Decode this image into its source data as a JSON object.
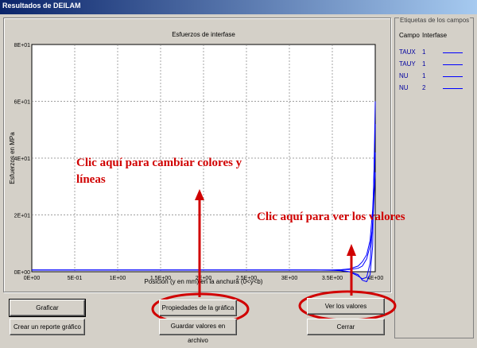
{
  "window": {
    "title": "Resultados de DEILAM"
  },
  "legend": {
    "group_title": "Etiquetas de los campos",
    "col_campo": "Campo",
    "col_interfase": "Interfase",
    "rows": [
      {
        "campo": "TAUX",
        "interfase": "1"
      },
      {
        "campo": "TAUY",
        "interfase": "1"
      },
      {
        "campo": "NU",
        "interfase": "1"
      },
      {
        "campo": "NU",
        "interfase": "2"
      }
    ]
  },
  "chart_data": {
    "type": "line",
    "title": "Esfuerzos de interfase",
    "xlabel": "Posición (y en mm) en la anchura (0<y<b)",
    "ylabel": "Esfuerzos en MPa",
    "xlim": [
      0,
      4
    ],
    "ylim": [
      0,
      8
    ],
    "x_ticks": [
      "0E+00",
      "5E-01",
      "1E+00",
      "1.5E+00",
      "2E+00",
      "2.5E+00",
      "3E+00",
      "3.5E+00",
      "4E+00"
    ],
    "x_tick_values": [
      0,
      0.5,
      1,
      1.5,
      2,
      2.5,
      3,
      3.5,
      4
    ],
    "y_ticks": [
      "0E+00",
      "2E+01",
      "4E+01",
      "6E+01",
      "8E+01"
    ],
    "y_tick_values": [
      0,
      2,
      4,
      6,
      8
    ],
    "grid": true,
    "color": "#0000ff",
    "series": [
      {
        "x": [
          0,
          0.5,
          1,
          1.5,
          2,
          2.5,
          3,
          3.3,
          3.5,
          3.6,
          3.7,
          3.8,
          3.85,
          3.9,
          3.94,
          3.97,
          4.0
        ],
        "y": [
          0.06,
          0.06,
          0.06,
          0.06,
          0.06,
          0.06,
          0.06,
          0.06,
          0.06,
          0.07,
          0.08,
          0.12,
          0.2,
          0.45,
          0.9,
          1.6,
          3.5
        ]
      },
      {
        "x": [
          0,
          0.5,
          1,
          1.5,
          2,
          2.5,
          3,
          3.3,
          3.5,
          3.6,
          3.7,
          3.8,
          3.85,
          3.9,
          3.94,
          3.97,
          4.0
        ],
        "y": [
          0.06,
          0.06,
          0.06,
          0.06,
          0.06,
          0.06,
          0.06,
          0.06,
          0.05,
          0.04,
          0.0,
          -0.15,
          -0.25,
          -0.2,
          0.3,
          1.8,
          5.2
        ]
      },
      {
        "x": [
          0,
          0.5,
          1,
          1.5,
          2,
          2.5,
          3,
          3.3,
          3.5,
          3.6,
          3.7,
          3.8,
          3.85,
          3.9,
          3.94,
          3.97,
          4.0
        ],
        "y": [
          0.06,
          0.06,
          0.06,
          0.06,
          0.06,
          0.06,
          0.06,
          0.06,
          0.06,
          0.07,
          0.1,
          0.2,
          0.35,
          0.6,
          1.1,
          2.2,
          4.2
        ]
      },
      {
        "x": [
          0,
          0.5,
          1,
          1.5,
          2,
          2.5,
          3,
          3.3,
          3.5,
          3.6,
          3.7,
          3.8,
          3.85,
          3.9,
          3.94,
          3.97,
          4.0
        ],
        "y": [
          0.06,
          0.06,
          0.06,
          0.06,
          0.06,
          0.06,
          0.06,
          0.06,
          0.06,
          0.05,
          0.0,
          -0.1,
          -0.3,
          -0.35,
          -0.1,
          0.9,
          6.0
        ]
      }
    ]
  },
  "annotations": {
    "left": "Clic aquí para cambiar colores y líneas",
    "left_line1": "Clic aquí para cambiar colores y",
    "left_line2": "líneas",
    "right": "Clic aquí para ver los valores",
    "color": "#d00000"
  },
  "buttons": {
    "graficar": "Graficar",
    "crear_reporte": "Crear un reporte gráfico",
    "propiedades": "Propiedades de la gráfica",
    "guardar": "Guardar valores en archivo",
    "ver_valores": "Ver los valores",
    "cerrar": "Cerrar"
  }
}
